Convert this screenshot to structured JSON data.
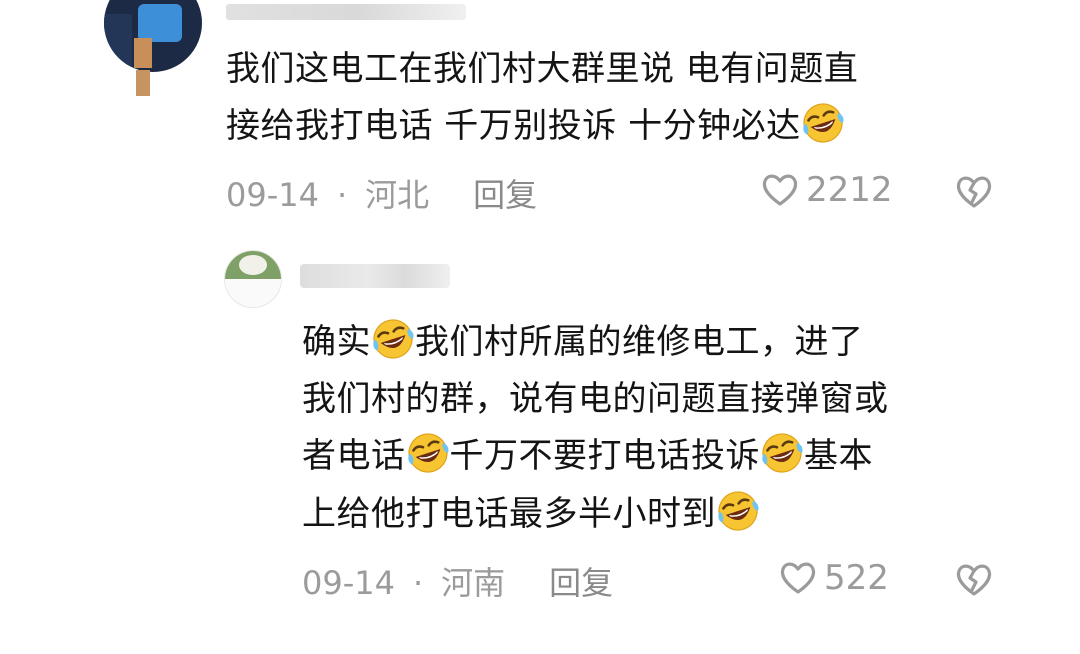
{
  "comments": [
    {
      "text_line1": "我们这电工在我们村大群里说 电有问题直",
      "text_line2": "接给我打电话 千万别投诉 十分钟必达",
      "date": "09-14",
      "location": "河北",
      "reply_label": "回复",
      "likes": "2212",
      "emoji": "face-with-tears-of-joy"
    },
    {
      "segments": {
        "l1a": "确实",
        "l1b": "我们村所属的维修电工，进了",
        "l2": "我们村的群，说有电的问题直接弹窗或",
        "l3a": "者电话",
        "l3b": "千万不要打电话投诉",
        "l3c": "基本",
        "l4": "上给他打电话最多半小时到"
      },
      "date": "09-14",
      "location": "河南",
      "reply_label": "回复",
      "likes": "522",
      "emoji": "face-with-tears-of-joy"
    }
  ],
  "colors": {
    "text": "#141414",
    "meta": "#9b9b9b",
    "emoji_face": "#f7c531"
  },
  "icons": {
    "like": "heart-outline-icon",
    "dislike": "broken-heart-icon",
    "emoji": "laughing-crying-emoji-icon"
  }
}
